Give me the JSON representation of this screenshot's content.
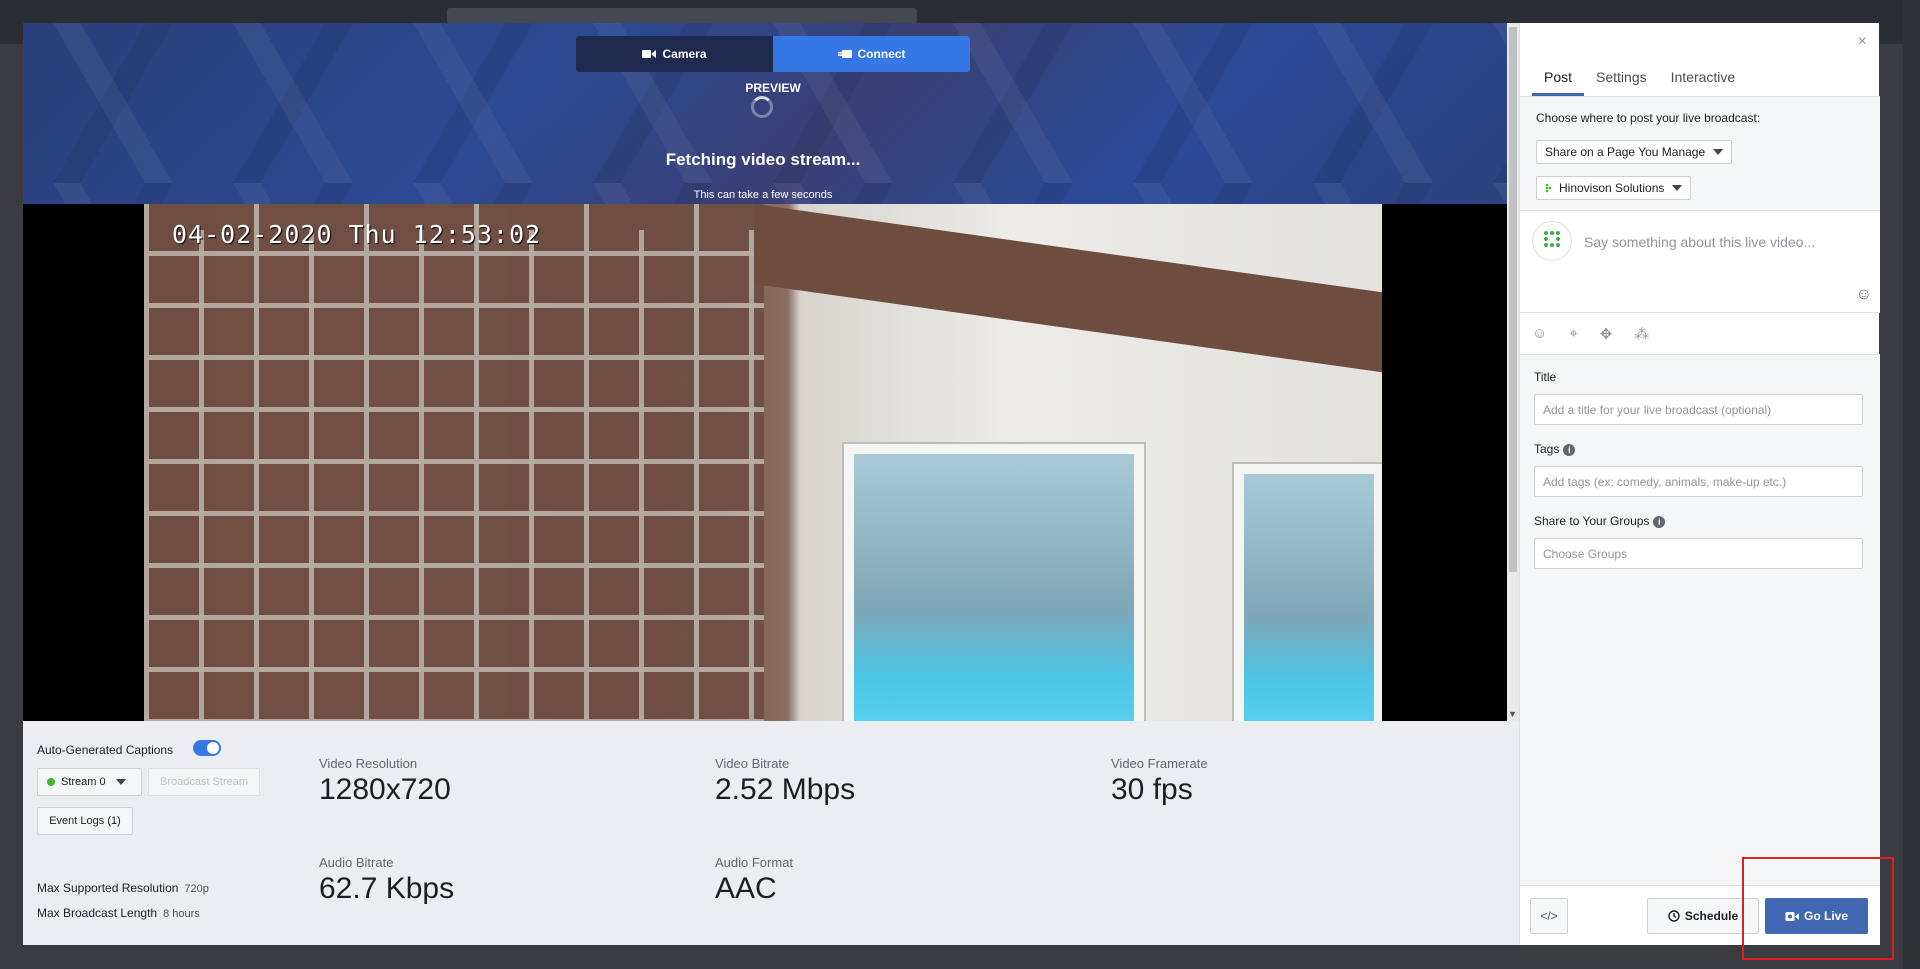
{
  "modal": {
    "source_tabs": {
      "camera": "Camera",
      "connect": "Connect"
    },
    "preview_label": "PREVIEW",
    "fetching_title": "Fetching video stream...",
    "fetching_subtitle": "This can take a few seconds",
    "video_timestamp": "04-02-2020 Thu 12:53:02"
  },
  "stats": {
    "captions_label": "Auto-Generated Captions",
    "captions_on": true,
    "stream_select": "Stream 0",
    "broadcast_stream_label": "Broadcast Stream",
    "event_logs_label": "Event Logs (1)",
    "max_resolution_label": "Max Supported Resolution",
    "max_resolution_value": "720p",
    "max_length_label": "Max Broadcast Length",
    "max_length_value": "8 hours",
    "items": [
      {
        "label": "Video Resolution",
        "value": "1280x720"
      },
      {
        "label": "Video Bitrate",
        "value": "2.52 Mbps"
      },
      {
        "label": "Video Framerate",
        "value": "30 fps"
      },
      {
        "label": "Audio Bitrate",
        "value": "62.7 Kbps"
      },
      {
        "label": "Audio Format",
        "value": "AAC"
      }
    ]
  },
  "panel": {
    "close": "×",
    "tabs": [
      "Post",
      "Settings",
      "Interactive"
    ],
    "choose_label": "Choose where to post your live broadcast:",
    "share_dropdown": "Share on a Page You Manage",
    "page_dropdown": "Hinovison Solutions",
    "compose_placeholder": "Say something about this live video...",
    "title_label": "Title",
    "title_placeholder": "Add a title for your live broadcast (optional)",
    "tags_label": "Tags",
    "tags_placeholder": "Add tags (ex: comedy, animals, make-up etc.)",
    "groups_label": "Share to Your Groups",
    "groups_placeholder": "Choose Groups",
    "embed_label": "</>",
    "schedule_label": "Schedule",
    "golive_label": "Go Live"
  },
  "colors": {
    "accent": "#3578e5",
    "golive": "#4267b2",
    "highlight": "#e0201b"
  }
}
